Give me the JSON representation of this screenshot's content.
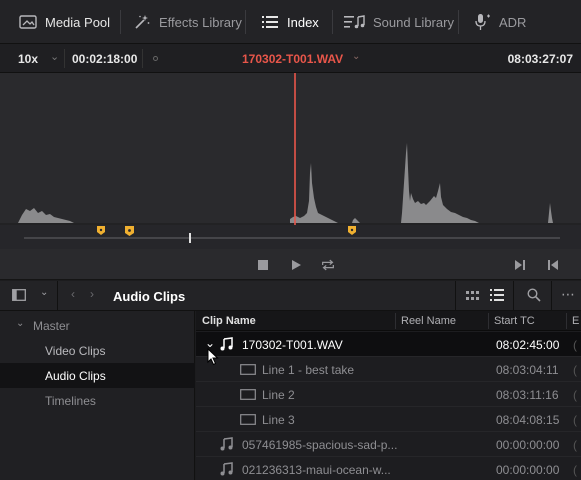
{
  "tabs": [
    {
      "label": "Media Pool",
      "icon": "media-pool-icon"
    },
    {
      "label": "Effects Library",
      "icon": "effects-wand-icon"
    },
    {
      "label": "Index",
      "icon": "index-list-icon",
      "active": true
    },
    {
      "label": "Sound Library",
      "icon": "sound-library-icon"
    },
    {
      "label": "ADR",
      "icon": "microphone-icon"
    }
  ],
  "viewer": {
    "zoom": "10x",
    "duration": "00:02:18:00",
    "clip_name": "170302-T001.WAV",
    "timecode": "08:03:27:07",
    "clip_name_color": "#e8564a"
  },
  "media_pool": {
    "current_bin": "Audio Clips",
    "bins": [
      {
        "label": "Master",
        "expanded": true
      },
      {
        "label": "Video Clips"
      },
      {
        "label": "Audio Clips",
        "selected": true
      },
      {
        "label": "Timelines"
      }
    ]
  },
  "table": {
    "columns": [
      "Clip Name",
      "Reel Name",
      "Start TC",
      "E"
    ],
    "rows": [
      {
        "name": "170302-T001.WAV",
        "start_tc": "08:02:45:00",
        "type": "audio",
        "expanded": true,
        "selected": true
      },
      {
        "name": "Line 1 - best take",
        "start_tc": "08:03:04:11",
        "type": "subclip"
      },
      {
        "name": "Line 2",
        "start_tc": "08:03:11:16",
        "type": "subclip"
      },
      {
        "name": "Line 3",
        "start_tc": "08:04:08:15",
        "type": "subclip"
      },
      {
        "name": "057461985-spacious-sad-p...",
        "start_tc": "00:00:00:00",
        "type": "audio"
      },
      {
        "name": "021236313-maui-ocean-w...",
        "start_tc": "00:00:00:00",
        "type": "audio"
      }
    ]
  },
  "colors": {
    "playhead": "#e8564a",
    "marker": "#f0b030",
    "waveform": "#8a8a8c"
  }
}
